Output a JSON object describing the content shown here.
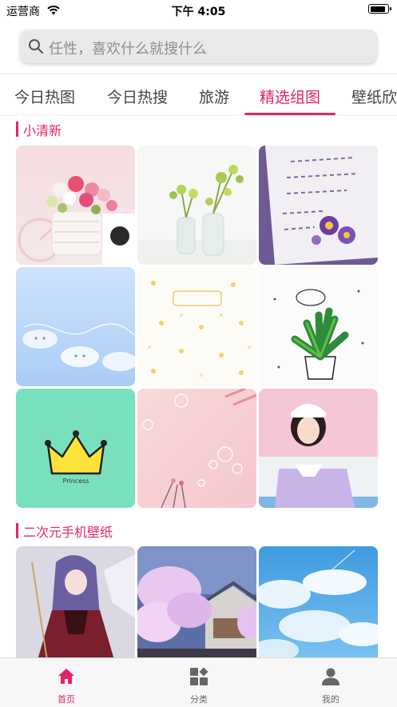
{
  "status_bar": {
    "carrier": "运营商",
    "time": "下午 4:05",
    "battery_level": 0.9
  },
  "search": {
    "placeholder": "任性，喜欢什么就搜什么",
    "icon": "search-icon"
  },
  "tabs": [
    {
      "label": "今日热图",
      "active": false
    },
    {
      "label": "今日热搜",
      "active": false
    },
    {
      "label": "旅游",
      "active": false
    },
    {
      "label": "精选组图",
      "active": true
    },
    {
      "label": "壁纸欣",
      "active": false
    }
  ],
  "sections": [
    {
      "title": "小清新",
      "images": [
        "flower-bicycle-photo",
        "glass-vase-plants-photo",
        "purple-flower-notes-photo",
        "cloud-sky-illustration",
        "yellow-pattern-wallpaper",
        "potted-plant-sketch",
        "princess-crown-illustration",
        "pink-bubbles-photo",
        "girl-portrait-photo"
      ]
    },
    {
      "title": "二次元手机壁纸",
      "images": [
        "anime-girl-artwork",
        "cherry-blossom-house-artwork",
        "blue-sky-clouds-artwork"
      ]
    }
  ],
  "bottom_nav": [
    {
      "label": "首页",
      "icon": "home-icon",
      "active": true
    },
    {
      "label": "分类",
      "icon": "category-grid-icon",
      "active": false
    },
    {
      "label": "我的",
      "icon": "person-icon",
      "active": false
    }
  ],
  "colors": {
    "accent": "#e0246b",
    "search_bg": "#e9e9ea",
    "bottom_bg": "#f7f7f7"
  },
  "illustration_text": {
    "crown_caption": "Princess"
  }
}
